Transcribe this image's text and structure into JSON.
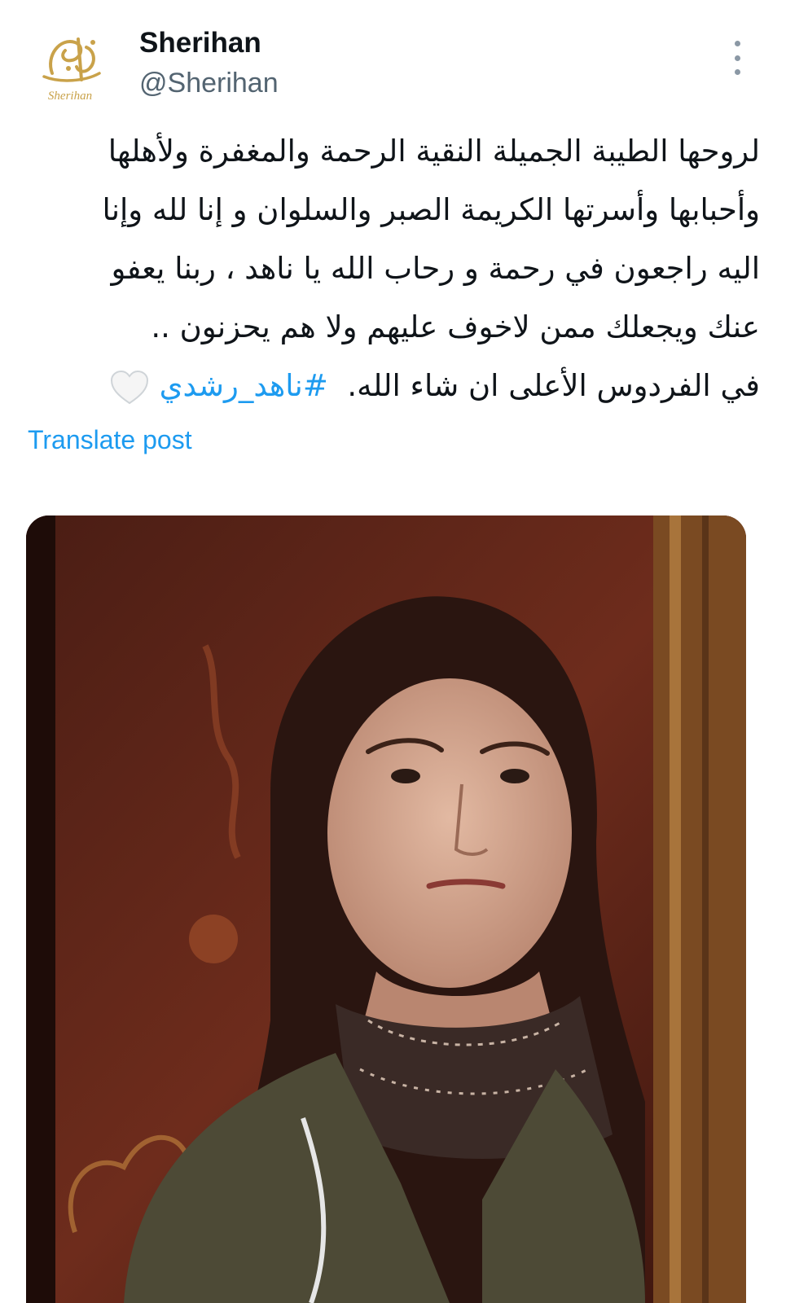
{
  "user": {
    "display_name": "Sherihan",
    "handle": "@Sherihan",
    "avatar_icon": "sherihan-calligraphy-logo",
    "avatar_logo_text": "Sherihan"
  },
  "post": {
    "lines": [
      "لروحها الطيبة الجميلة النقية الرحمة والمغفرة ولأهلها",
      "وأحبابها وأسرتها الكريمة الصبر والسلوان و إنا لله وإنا",
      "اليه راجعون في رحمة و رحاب الله يا ناهد ، ربنا يعفو",
      "عنك ويجعلك ممن لاخوف عليهم ولا هم يحزنون .."
    ],
    "last_line_text": "في الفردوس الأعلى ان شاء الله.",
    "hashtag": "#ناهد_رشدي",
    "emoji_icon": "white-heart-icon",
    "translate_label": "Translate post"
  },
  "media": {
    "type": "photo",
    "description_icon": "portrait-photo"
  },
  "colors": {
    "link": "#1d9bf0",
    "text": "#0f1419",
    "secondary": "#536471",
    "logo_gold": "#c9a24a"
  }
}
